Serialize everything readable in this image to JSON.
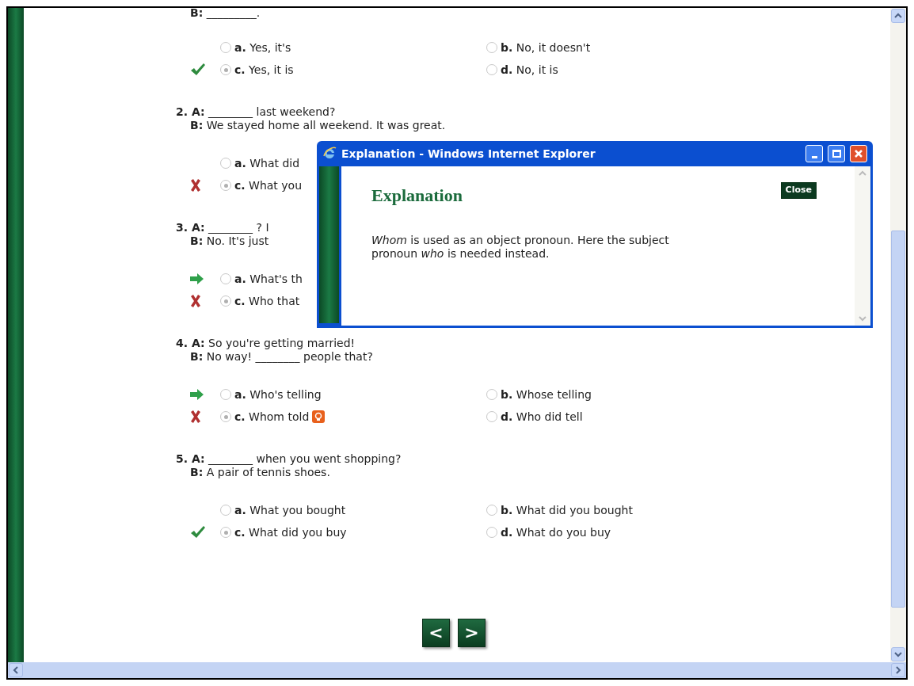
{
  "questions": [
    {
      "lines": [
        {
          "speaker": "B:",
          "text": "_________."
        }
      ],
      "option_rows": [
        [
          {
            "letter": "a.",
            "text": "Yes, it's",
            "selected": false
          },
          {
            "letter": "b.",
            "text": "No, it doesn't",
            "selected": false
          }
        ],
        [
          {
            "letter": "c.",
            "text": "Yes, it is",
            "selected": true,
            "kind": "check"
          },
          {
            "letter": "d.",
            "text": "No, it is",
            "selected": false
          }
        ]
      ]
    },
    {
      "number": "2.",
      "lines": [
        {
          "speaker": "A:",
          "text": "________ last weekend?"
        },
        {
          "speaker": "B:",
          "text": "We stayed home all weekend. It was great."
        }
      ],
      "option_rows": [
        [
          {
            "letter": "a.",
            "text": "What did",
            "selected": false
          }
        ],
        [
          {
            "letter": "c.",
            "text": "What you",
            "selected": true,
            "kind": "cross"
          }
        ]
      ]
    },
    {
      "number": "3.",
      "lines": [
        {
          "speaker": "A:",
          "text": "________ ? I"
        },
        {
          "speaker": "B:",
          "text": "No. It's just"
        }
      ],
      "option_rows": [
        [
          {
            "letter": "a.",
            "text": "What's th",
            "selected": false,
            "kind": "arrow"
          }
        ],
        [
          {
            "letter": "c.",
            "text": "Who that",
            "selected": true,
            "kind": "cross"
          }
        ]
      ]
    },
    {
      "number": "4.",
      "lines": [
        {
          "speaker": "A:",
          "text": "So you're getting married!"
        },
        {
          "speaker": "B:",
          "text": "No way! ________ people that?"
        }
      ],
      "option_rows": [
        [
          {
            "letter": "a.",
            "text": "Who's telling",
            "selected": false,
            "kind": "arrow"
          },
          {
            "letter": "b.",
            "text": "Whose telling",
            "selected": false
          }
        ],
        [
          {
            "letter": "c.",
            "text": "Whom told",
            "selected": true,
            "kind": "cross",
            "info": true
          },
          {
            "letter": "d.",
            "text": "Who did tell",
            "selected": false
          }
        ]
      ]
    },
    {
      "number": "5.",
      "lines": [
        {
          "speaker": "A:",
          "text": "________ when you went shopping?"
        },
        {
          "speaker": "B:",
          "text": "A pair of tennis shoes."
        }
      ],
      "option_rows": [
        [
          {
            "letter": "a.",
            "text": "What you bought",
            "selected": false
          },
          {
            "letter": "b.",
            "text": "What did you bought",
            "selected": false
          }
        ],
        [
          {
            "letter": "c.",
            "text": "What did you buy",
            "selected": true,
            "kind": "check"
          },
          {
            "letter": "d.",
            "text": "What do you buy",
            "selected": false
          }
        ]
      ]
    }
  ],
  "nav": {
    "previous": "<",
    "next": ">"
  },
  "popup": {
    "title": "Explanation - Windows Internet Explorer",
    "heading": "Explanation",
    "close": "Close",
    "body": "*Whom* is used as an object pronoun. Here the subject pronoun *who* is needed instead."
  }
}
